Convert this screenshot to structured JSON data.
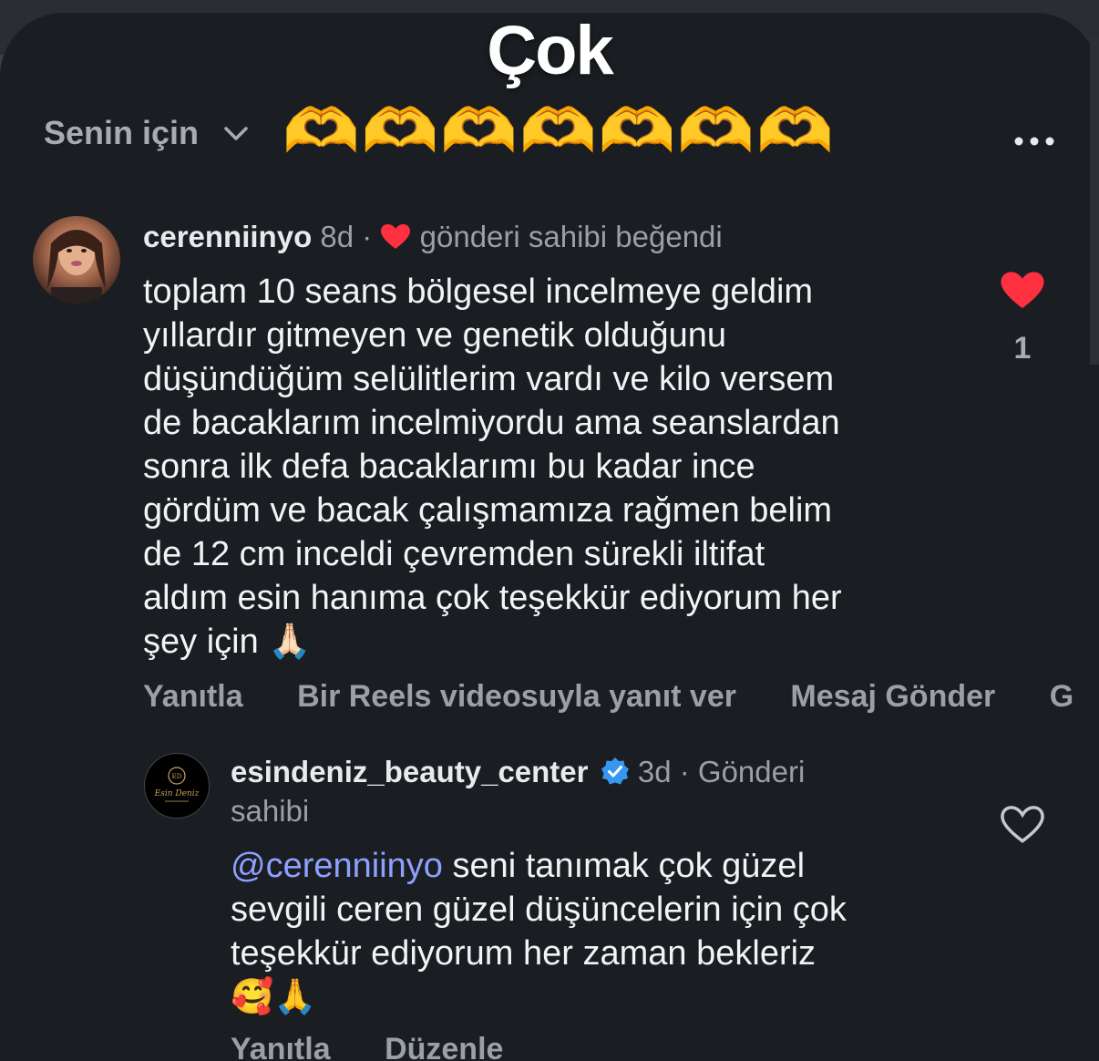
{
  "overlay": {
    "title": "Çok"
  },
  "header": {
    "filter_label": "Senin için",
    "hearts": "🫶🫶🫶🫶🫶🫶🫶"
  },
  "comment": {
    "username": "cerenniinyo",
    "age": "8d",
    "separator": "·",
    "liked_by_owner": "gönderi sahibi beğendi",
    "text_lines": [
      "toplam 10 seans bölgesel incelmeye geldim",
      "yıllardır gitmeyen ve genetik olduğunu",
      "düşündüğüm selülitlerim vardı ve kilo versem",
      "de bacaklarım incelmiyordu ama seanslardan",
      "sonra ilk defa bacaklarımı bu kadar ince",
      "gördüm ve bacak çalışmamıza rağmen belim",
      "de 12 cm inceldi çevremden sürekli iltifat",
      "aldım esin hanıma çok teşekkür ediyorum her",
      "şey için 🙏🏻"
    ],
    "like_count": "1",
    "actions": {
      "reply": "Yanıtla",
      "reels_reply": "Bir Reels videosuyla yanıt ver",
      "send_message": "Mesaj Gönder",
      "overflow": "G"
    }
  },
  "reply": {
    "username": "esindeniz_beauty_center",
    "age": "3d",
    "separator": "·",
    "owner_label_1": "Gönderi",
    "owner_label_2": "sahibi",
    "mention": "@cerenniinyo",
    "text_line_1": " seni tanımak çok güzel",
    "text_line_2": "sevgili ceren güzel düşüncelerin için çok",
    "text_line_3": "teşekkür ediyorum her zaman bekleriz",
    "text_line_4": "🥰🙏",
    "avatar_text": "Esin Deniz",
    "actions": {
      "reply": "Yanıtla",
      "edit": "Düzenle"
    }
  },
  "colors": {
    "background": "#1a1d21",
    "heart_red": "#ff3040",
    "verified_blue": "#3797f0",
    "mention": "#8ea0ff"
  }
}
